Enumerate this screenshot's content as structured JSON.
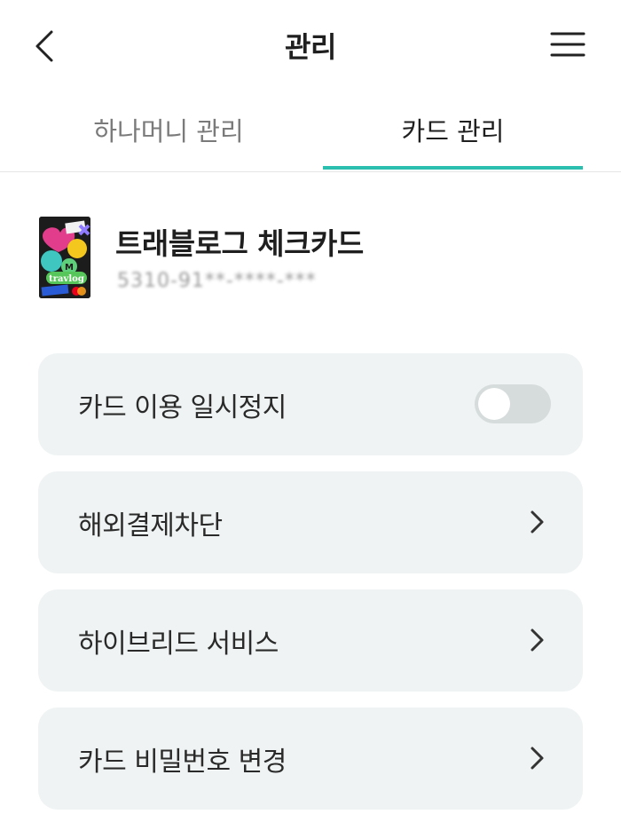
{
  "header": {
    "title": "관리",
    "back_icon": "chevron-left-icon",
    "menu_icon": "hamburger-menu-icon"
  },
  "tabs": [
    {
      "label": "하나머니 관리",
      "active": false
    },
    {
      "label": "카드 관리",
      "active": true
    }
  ],
  "card": {
    "name": "트래블로그 체크카드",
    "number_masked": "5310-91**-****-***",
    "image_icon": "travlog-card-image"
  },
  "menu_items": [
    {
      "label": "카드 이용 일시정지",
      "control": "toggle",
      "toggle_on": false
    },
    {
      "label": "해외결제차단",
      "control": "chevron"
    },
    {
      "label": "하이브리드 서비스",
      "control": "chevron"
    },
    {
      "label": "카드 비밀번호 변경",
      "control": "chevron"
    }
  ],
  "colors": {
    "accent": "#2bbfb0",
    "item_bg": "#eff3f3",
    "toggle_off": "#d6dbdb",
    "inactive_tab": "#7a7a7a"
  }
}
